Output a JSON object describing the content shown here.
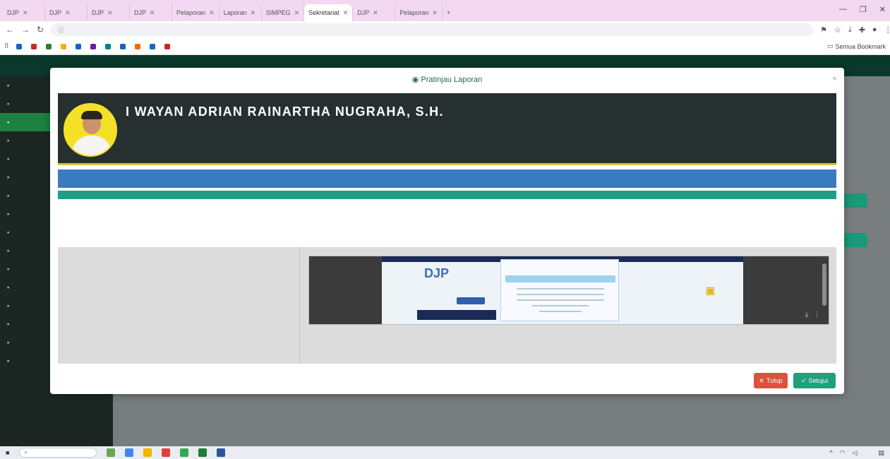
{
  "browser": {
    "tabs": [
      {
        "label": "DJP",
        "active": false
      },
      {
        "label": "DJP",
        "active": false
      },
      {
        "label": "DJP",
        "active": false
      },
      {
        "label": "DJP",
        "active": false
      },
      {
        "label": "Pelaporan",
        "active": false
      },
      {
        "label": "Laporan",
        "active": false
      },
      {
        "label": "SIMPEG",
        "active": false
      },
      {
        "label": "Sekretariat",
        "active": true
      },
      {
        "label": "DJP",
        "active": false
      },
      {
        "label": "Pelaporan",
        "active": false
      }
    ],
    "new_tab": "+",
    "window_controls": {
      "minimize": "—",
      "maximize": "❐",
      "close": "✕"
    },
    "url": "",
    "bookmarks": [
      "",
      "",
      "",
      "",
      "",
      "",
      "",
      "",
      "",
      "",
      ""
    ],
    "bookmarks_more": "Semua Bookmark"
  },
  "modal": {
    "title": "Pratinjau Laporan",
    "close": "×",
    "profile": {
      "name": "I WAYAN ADRIAN RAINARTHA NUGRAHA, S.H.",
      "lines": [
        "",
        "",
        "",
        ""
      ],
      "email": ""
    },
    "blue_bar_text": "",
    "info": [
      {
        "label": "",
        "value": ""
      },
      {
        "label": "",
        "value": ""
      },
      {
        "label": "",
        "value": ""
      }
    ],
    "doc_label": "",
    "buttons": {
      "close": "Tutup",
      "verify": "Setujui"
    }
  },
  "colors": {
    "profile_bg": "#263030",
    "accent_yellow": "#d6c63d",
    "blue_bar": "#3a7bbf",
    "teal_bar": "#1f9e87",
    "btn_red": "#d9533f",
    "btn_green": "#1fa07b"
  },
  "taskbar": {
    "search_placeholder": "",
    "time": "",
    "date": ""
  }
}
